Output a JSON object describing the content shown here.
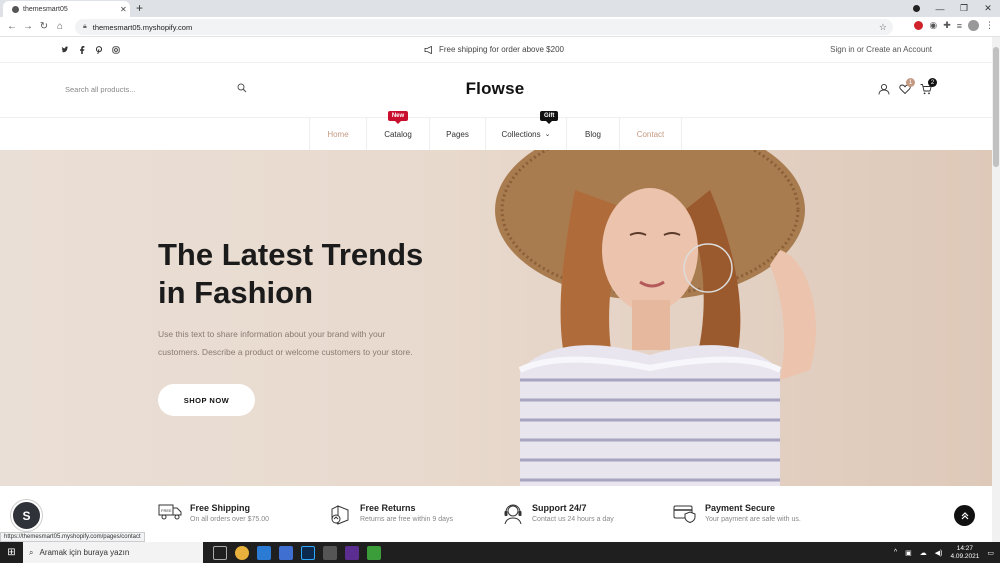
{
  "browser": {
    "tab_title": "themesmart05",
    "new_tab": "+",
    "url": "themesmart05.myshopify.com",
    "status_url": "https://themesmart05.myshopify.com/pages/contact"
  },
  "announcement": {
    "shipping": "Free shipping for order above $200",
    "account": "Sign in or Create an Account"
  },
  "header": {
    "search_placeholder": "Search all products...",
    "logo": "Flowse",
    "wishlist_count": "1",
    "cart_count": "2"
  },
  "menu": {
    "items": [
      {
        "label": "Home"
      },
      {
        "label": "Catalog",
        "badge": "New"
      },
      {
        "label": "Pages"
      },
      {
        "label": "Collections",
        "badge": "Gift"
      },
      {
        "label": "Blog"
      },
      {
        "label": "Contact"
      }
    ]
  },
  "hero": {
    "title_line1": "The Latest Trends",
    "title_line2": "in Fashion",
    "text_line1": "Use this text to share information about your brand with your",
    "text_line2": "customers. Describe a product or welcome customers to your store.",
    "button": "SHOP NOW"
  },
  "features": [
    {
      "title": "Free Shipping",
      "subtitle": "On all orders over $75.00",
      "icon": "truck-icon"
    },
    {
      "title": "Free Returns",
      "subtitle": "Returns are free within 9 days",
      "icon": "box-return-icon"
    },
    {
      "title": "Support 24/7",
      "subtitle": "Contact us 24 hours a day",
      "icon": "headset-icon"
    },
    {
      "title": "Payment Secure",
      "subtitle": "Your payment are safe with us.",
      "icon": "card-shield-icon"
    }
  ],
  "taskbar": {
    "search": "Aramak için buraya yazın",
    "time": "14:27",
    "date": "4.09.2021"
  },
  "colors": {
    "accent": "#c49a83",
    "badge_new": "#c8102e",
    "badge_gift": "#111111",
    "hero_bg": "#e8d9cd"
  }
}
